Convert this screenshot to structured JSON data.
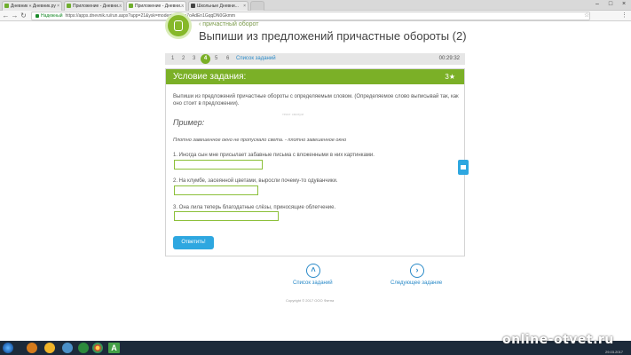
{
  "browser": {
    "tabs": [
      {
        "title": "Дневник « Дневник.ру"
      },
      {
        "title": "Приложение - Дневни..."
      },
      {
        "title": "Приложение - Дневни..."
      },
      {
        "title": "Школьные Дневни..."
      },
      {
        "title": ""
      }
    ],
    "secure_label": "Надежный",
    "url": "https://apps.dnevnik.ru/run.aspx?app=21&ysk=mode=test&=e7oAdEn1GqqDN0Gkmm"
  },
  "header": {
    "breadcrumb": "‹ причастный оборот",
    "title": "Выпиши из предложений причастные обороты (2)"
  },
  "stepper": {
    "steps": [
      "1",
      "2",
      "3",
      "4",
      "5",
      "6"
    ],
    "current": "4",
    "task_list_link": "Список заданий",
    "timer": "00:29:32"
  },
  "card": {
    "title": "Условие задания:",
    "points": "3★",
    "instruction": "Выпиши из предложений причастные обороты с определяемым словом. (Определяемое слово выписывай так, как оно стоит в предложении).",
    "faint_mark": "текст смотри",
    "example_label": "Пример:",
    "example_text": "Плотно завешенное окно не пропускало света. - плотно завешенное окно",
    "questions": [
      {
        "text": "1. Иногда сын мне присылает забавные письма с вложенными в них картинками.",
        "value": ""
      },
      {
        "text": "2. На клумбе, засеянной цветами, выросли почему-то одуванчики.",
        "value": ""
      },
      {
        "text": "3. Она лила теперь благодатные слёзы, приносящие облегчение.",
        "value": ""
      }
    ],
    "submit_label": "Ответить!"
  },
  "bottom_nav": {
    "list_label": "Список заданий",
    "next_label": "Следующее задание",
    "copyright": "Copyright © 2017 ООО Фитна"
  },
  "overlay": {
    "watermark": "online-otvet.ru",
    "tray_date": "29.03.2017"
  },
  "colors": {
    "accent_green": "#7bb027",
    "link_blue": "#2a8ac8",
    "button_blue": "#2ea7e0"
  }
}
